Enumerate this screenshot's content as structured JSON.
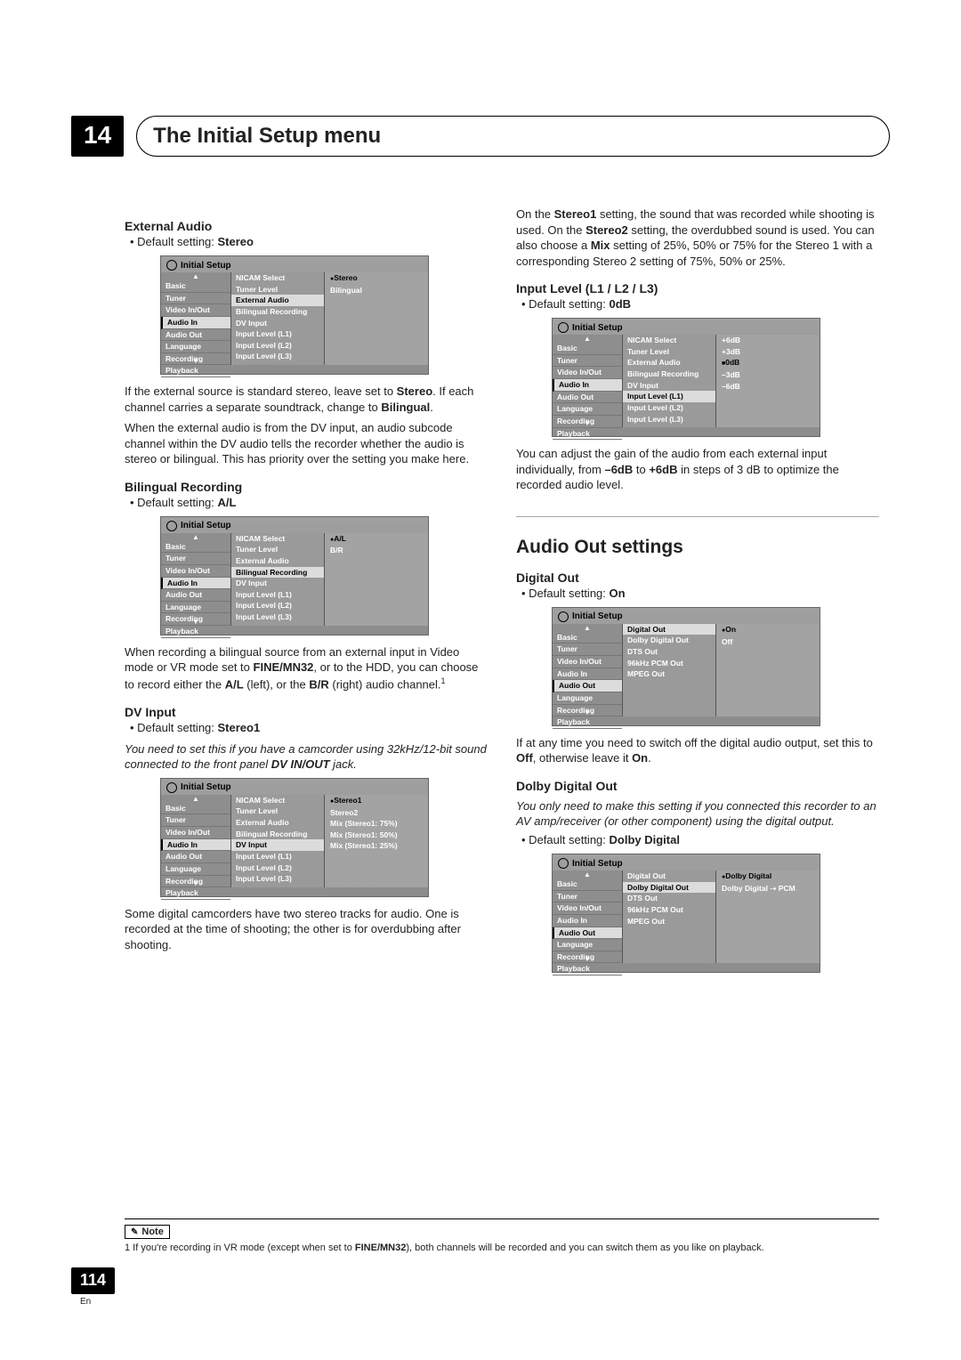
{
  "chapter": {
    "num": "14",
    "title": "The Initial Setup menu"
  },
  "nav_items": [
    "Basic",
    "Tuner",
    "Video In/Out",
    "Audio In",
    "Audio Out",
    "Language",
    "Recording",
    "Playback"
  ],
  "audio_in_mid": [
    "NICAM Select",
    "Tuner Level",
    "External Audio",
    "Bilingual Recording",
    "DV Input",
    "Input Level (L1)",
    "Input Level (L2)",
    "Input Level (L3)"
  ],
  "audio_out_mid": [
    "Digital Out",
    "Dolby Digital Out",
    "DTS Out",
    "96kHz PCM Out",
    "MPEG Out"
  ],
  "left": {
    "external_audio": {
      "heading": "External Audio",
      "default_label": "Default setting: ",
      "default_value": "Stereo",
      "opts": [
        "Stereo",
        "Bilingual"
      ],
      "p1a": "If the external source is standard stereo, leave set to ",
      "p1b": ". If each channel carries a separate soundtrack, change to ",
      "p1c": ".",
      "p2": "When the external audio is from the DV input, an audio subcode channel within the DV audio tells the recorder whether the audio is stereo or bilingual. This has priority over the setting you make here."
    },
    "bilingual_rec": {
      "heading": "Bilingual Recording",
      "default_label": "Default setting: ",
      "default_value": "A/L",
      "opts": [
        "A/L",
        "B/R"
      ],
      "p1a": "When recording a bilingual source from an external input in Video mode or VR mode set to ",
      "bold1": "FINE/MN32",
      "p1b": ", or to the HDD, you can choose to record either the ",
      "bold2": "A/L",
      "p1c": " (left), or the ",
      "bold3": "B/R",
      "p1d": " (right) audio channel.",
      "sup": "1"
    },
    "dv_input": {
      "heading": "DV Input",
      "default_label": "Default setting: ",
      "default_value": "Stereo1",
      "italic_a": "You need to set this if you have a camcorder using 32kHz/12-bit sound connected to the front panel ",
      "italic_bold": "DV IN/OUT",
      "italic_b": " jack.",
      "opts": [
        "Stereo1",
        "Stereo2",
        "Mix (Stereo1: 75%)",
        "Mix (Stereo1: 50%)",
        "Mix (Stereo1: 25%)"
      ],
      "p1": "Some digital camcorders have two stereo tracks for audio. One is recorded at the time of shooting; the other is for overdubbing after shooting."
    }
  },
  "right": {
    "top_p_a": "On the ",
    "top_bold1": "Stereo1",
    "top_p_b": " setting, the sound that was recorded while shooting is used. On the ",
    "top_bold2": "Stereo2",
    "top_p_c": " setting, the overdubbed sound is used. You can also choose a ",
    "top_bold3": "Mix",
    "top_p_d": " setting of 25%, 50% or 75% for the Stereo 1 with a corresponding Stereo 2 setting of 75%, 50% or 25%.",
    "input_level": {
      "heading": "Input Level (L1 / L2 / L3)",
      "default_label": "Default setting: ",
      "default_value": "0dB",
      "opts": [
        "+6dB",
        "+3dB",
        "0dB",
        "–3dB",
        "–6dB"
      ],
      "p1a": "You can adjust the gain of the audio from each external input individually, from ",
      "b1": "–6dB",
      "p1b": " to ",
      "b2": "+6dB",
      "p1c": " in steps of 3 dB to optimize the recorded audio level."
    },
    "audio_out_title": "Audio Out settings",
    "digital_out": {
      "heading": "Digital Out",
      "default_label": "Default setting: ",
      "default_value": "On",
      "opts": [
        "On",
        "Off"
      ],
      "p1a": "If at any time you need to switch off the digital audio output, set this to ",
      "b1": "Off",
      "p1b": ", otherwise leave it ",
      "b2": "On",
      "p1c": "."
    },
    "dolby_out": {
      "heading": "Dolby Digital Out",
      "italic": "You only need to make this setting if you connected this recorder to an AV amp/receiver (or other component) using the digital output.",
      "default_label": "Default setting: ",
      "default_value": "Dolby Digital",
      "opts": [
        "Dolby Digital",
        "Dolby Digital ➝ PCM"
      ]
    }
  },
  "note": {
    "label": "Note",
    "text_a": "1 If you're recording in VR mode (except when set to ",
    "bold": "FINE/MN32",
    "text_b": "), both channels will be recorded and you can switch them as you like on playback."
  },
  "page_num": "114",
  "page_lang": "En",
  "setup_label": "Initial Setup"
}
